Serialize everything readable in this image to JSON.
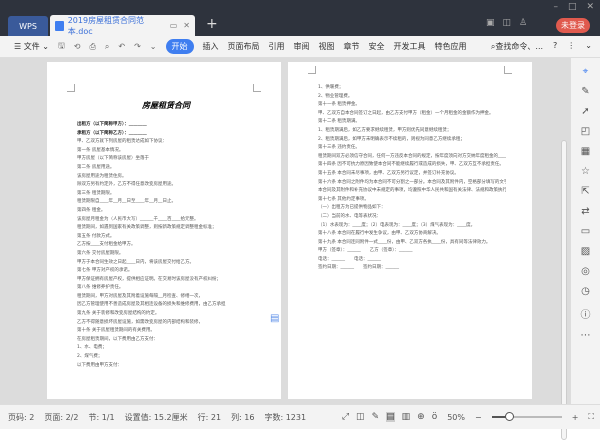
{
  "window": {
    "app_tab": "WPS",
    "doc_tab": "2019房屋租赁合同范本.doc",
    "new_tab": "+",
    "login": "未登录",
    "controls": [
      "–",
      "□",
      "✕"
    ]
  },
  "toolbar": {
    "file": "文件",
    "tabs": [
      "开始",
      "插入",
      "页面布局",
      "引用",
      "审阅",
      "视图",
      "章节",
      "安全",
      "开发工具",
      "特色应用"
    ],
    "search": "查找命令、...",
    "help": "?"
  },
  "document": {
    "page1": {
      "title": "房屋租赁合同",
      "lines": [
        "出租方（以下简称甲方）：________",
        "承租方（以下简称乙方）：________",
        "甲、乙双方就下列房屋的租赁达成如下协议：",
        "第一条 房屋基本情况。",
        "甲方房屋（以下简称该房屋）坐落于",
        "第二条 房屋用途。",
        "该房屋用途为租赁住房。",
        "除双方另有约定外，乙方不得任意改变房屋用途。",
        "第三条 租赁期限。",
        "租赁期限自____年__月__日至____年__月__日止。",
        "第四条 租金。",
        "该房屋月租金为（人民币大写）______千____百____拾元整。",
        "租赁期间，如遇到国家有关政策调整，则按新政策规定调整租金标准；",
        "第五条 付款方式。",
        "乙方按____支付租金给甲方。",
        "第六条 交付房屋期限。",
        "甲方于本合同生效之日起____日内，将该房屋交付给乙方。",
        "第七条 甲方对产权的承诺。",
        "甲方保证拥有房屋产权，提供相应证明。在交易时该房屋没有产权纠纷；",
        "第八条 维修养护责任。",
        "租赁期间，甲方对房屋及其附着设施每隔__月检查、修缮一次，",
        "因乙方管理使用不善造成房屋及其相连设备的损失和维修费用，由乙方承担",
        "第九条 关于装修和改变房屋结构的约定。",
        "乙方不得随意损坏房屋设施，如需改变房屋的内部结构和装修，",
        "第十条 关于房屋租赁期间的有关费用。",
        "在房屋租赁期间，以下费用由乙方支付：",
        "1、水、电费；",
        "2、煤气费；",
        "以下费用由甲方支付："
      ]
    },
    "page2": {
      "lines": [
        "1、供暖费；",
        "2、物业管理费。",
        "第十一条 租赁押金。",
        "甲、乙双方自本合同签订之日起，由乙方支付甲方（租金）一个月租金的金额作为押金。",
        "第十二条 租赁期满。",
        "1、租赁期满后，如乙方要求继续租赁，甲方则优先同意继续租赁；",
        "2、租赁期满后，如甲方未明确表示不续租的，则视为同意乙方继续承租；",
        "第十三条 违约责任。",
        "租赁期间双方必须信守合同，任何一方违反本合同的规定，按年度须向对方交纳年度租金的____%作为违约金。",
        "第十四条 因不可抗力原因致使本合同不能继续履行或造成的损失，甲、乙双方互不承担责任。",
        "第十五条 本合同未尽事项，由甲、乙双方另行议定，并签订补充协议。",
        "第十六条 本合同之附件均为本合同不可分割之一部分。本合同及其附件内，空格部分填写的文字与印刷文字具有同等效力。",
        "本合同及其附件和补充协议中未规定的事项，均遵照中华人民共和国有关法律、法规和政策执行。",
        "第十七条 其他约定事项。",
        "（一）出租方为已提供物品如下：",
        "（二）当前的水、电等表状况：",
        "（1）水表现为：____度；（2）电表现为：____度；（3）煤气表现为：____度。",
        "第十八条 本合同在履行中发生争议，由甲、乙双方协商解决。",
        "第十九条 本合同连同附件一式____份，由甲、乙双方各执____份，具有同等法律效力。",
        "甲方（签章）：______　　乙方（签章）：______",
        "电话：______　　电话：______",
        "签约日期：______　　签约日期：______"
      ]
    }
  },
  "statusbar": {
    "page": "页码: 2",
    "pages": "页面: 2/2",
    "section": "节: 1/1",
    "setting": "设置值: 15.2厘米",
    "row": "行: 21",
    "col": "列: 16",
    "words": "字数: 1231",
    "zoom": "50%",
    "zoom_value": 0.5
  }
}
